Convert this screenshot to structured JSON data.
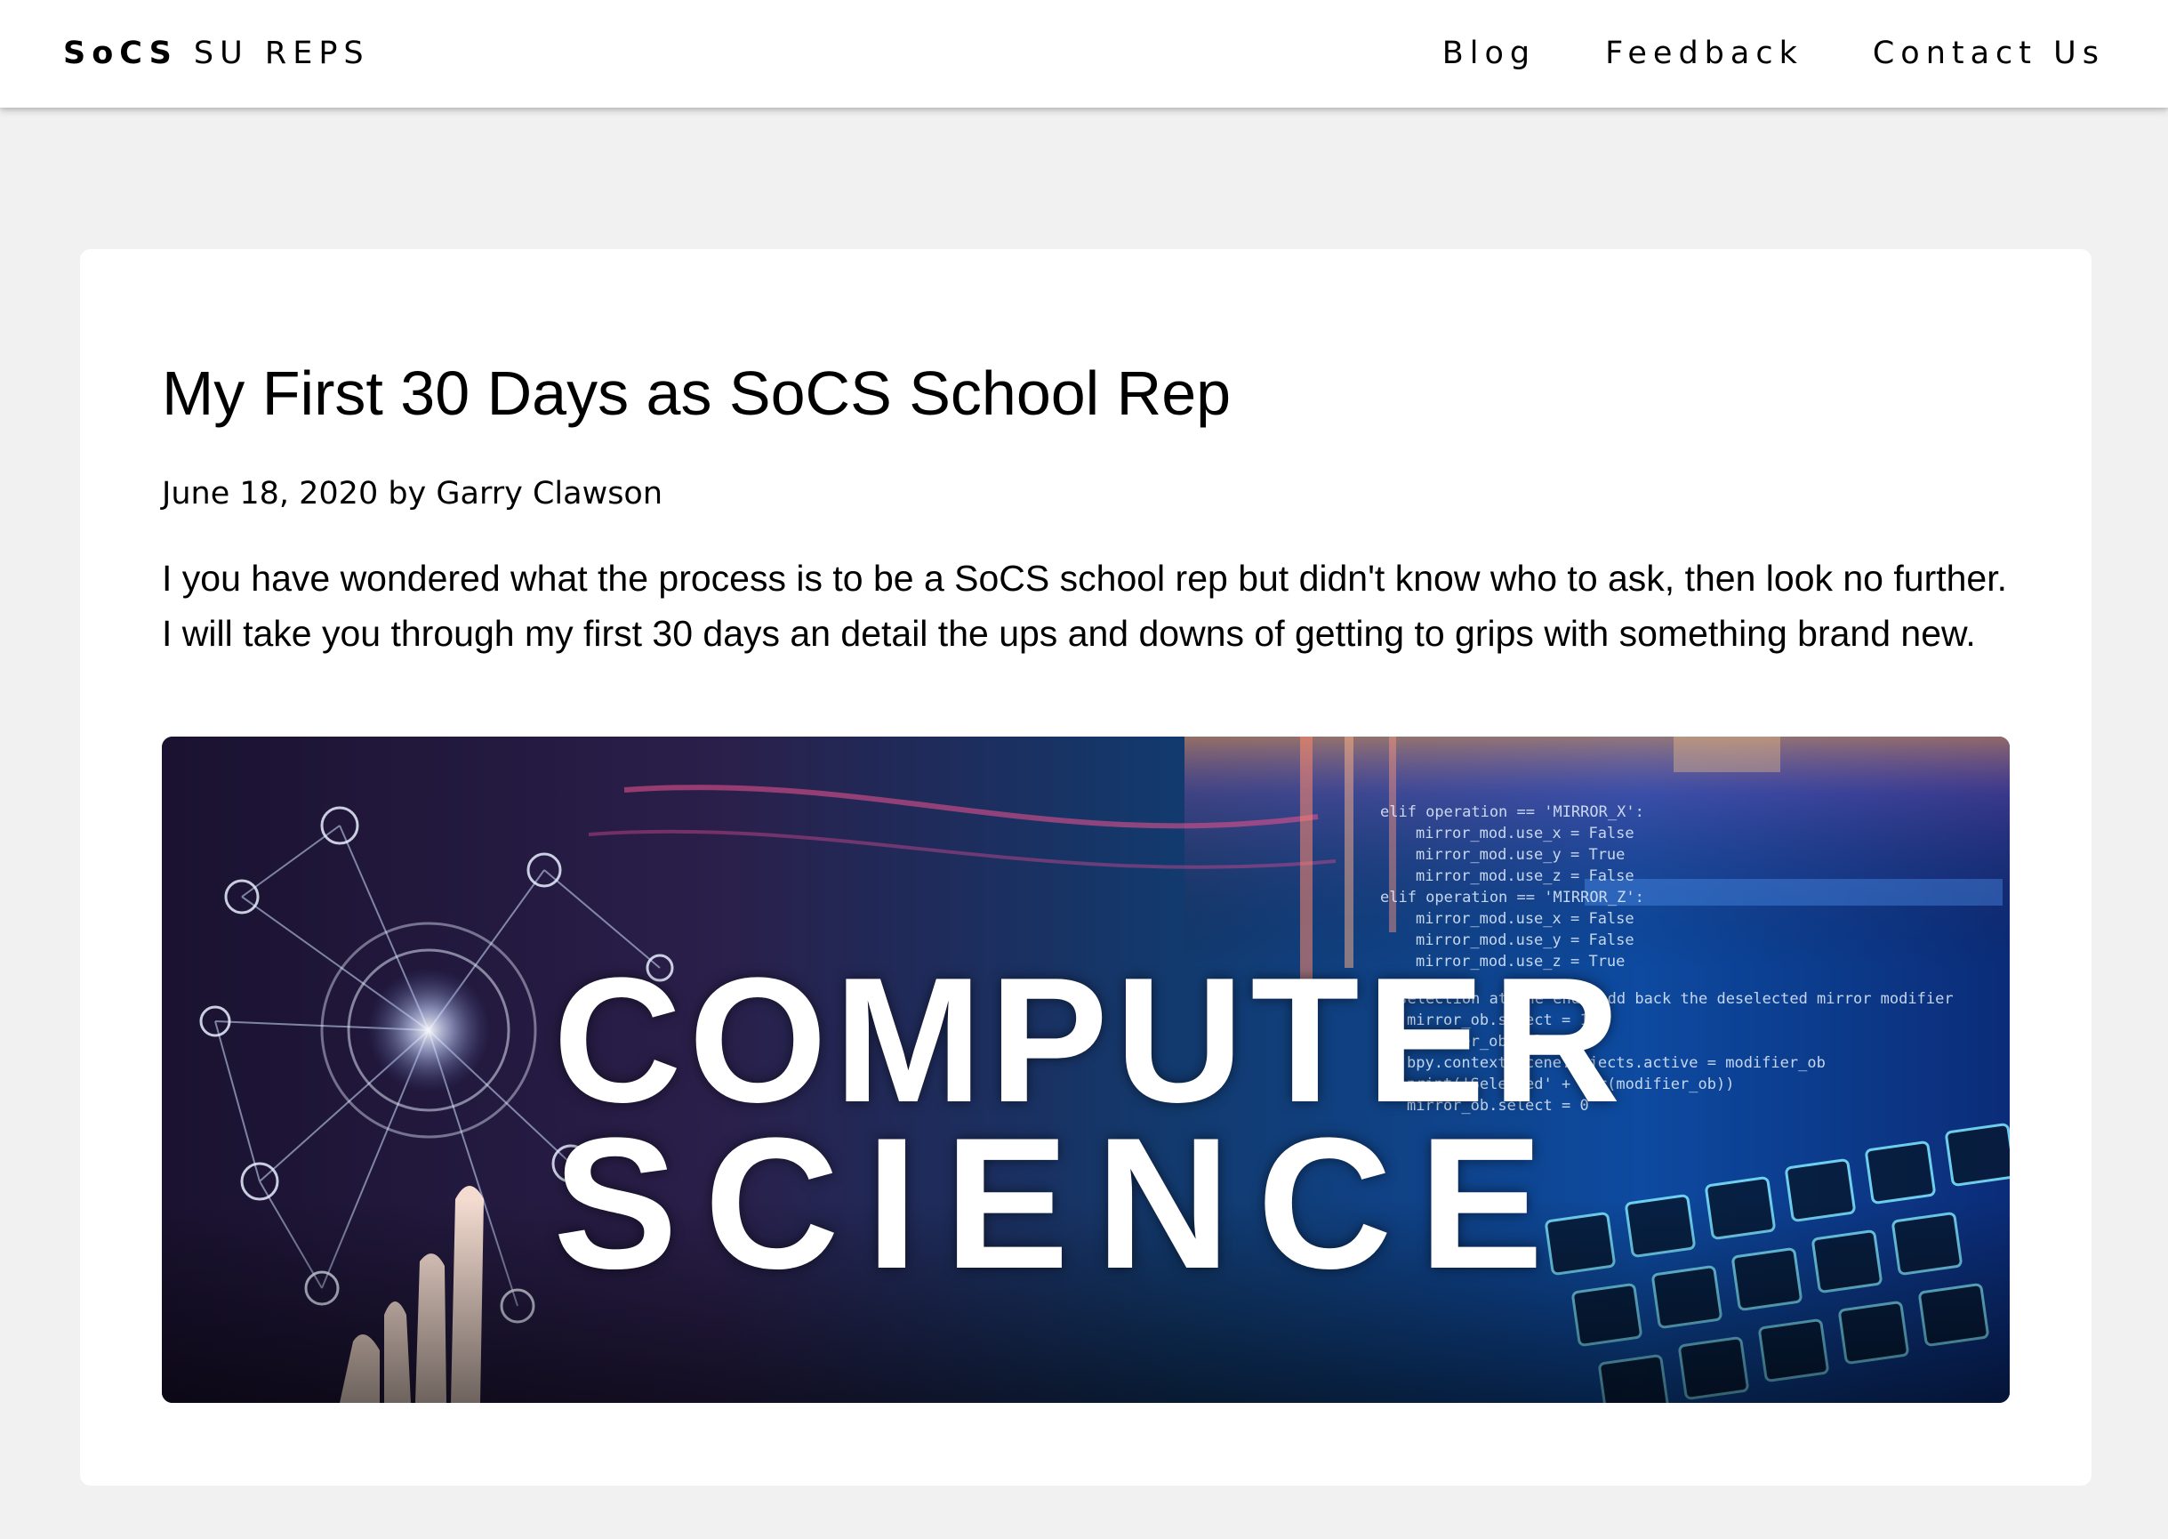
{
  "nav": {
    "brand_bold": "SoCS",
    "brand_rest": " SU REPS",
    "links": [
      "Blog",
      "Feedback",
      "Contact Us"
    ]
  },
  "post": {
    "title": "My First 30 Days as SoCS School Rep",
    "meta": "June 18, 2020 by Garry Clawson",
    "excerpt": "I you have wondered what the process is to be a SoCS school rep but didn't know who to ask, then look no further. I will take you through my first 30 days an detail the ups and downs of getting to grips with something brand new.",
    "image": {
      "line1": "COMPUTER",
      "line2": "SCIENCE",
      "code_lines": [
        "elif operation == 'MIRROR_X':",
        "mirror_mod.use_x = False",
        "mirror_mod.use_y = True",
        "mirror_mod.use_z = False",
        "elif operation == 'MIRROR_Z':",
        "mirror_mod.use_x = False",
        "mirror_mod.use_y = False",
        "mirror_mod.use_z = True",
        "#selection at the end -add back the deselected mirror modifier",
        "mirror_ob.select = 1",
        "modifier_ob.select=1",
        "bpy.context.scene.objects.active = modifier_ob",
        "print('Selected' + str(modifier_ob))",
        "mirror_ob.select = 0"
      ]
    }
  },
  "colors": {
    "page_bg": "#f1f1f1",
    "card_bg": "#ffffff",
    "text": "#000000"
  }
}
